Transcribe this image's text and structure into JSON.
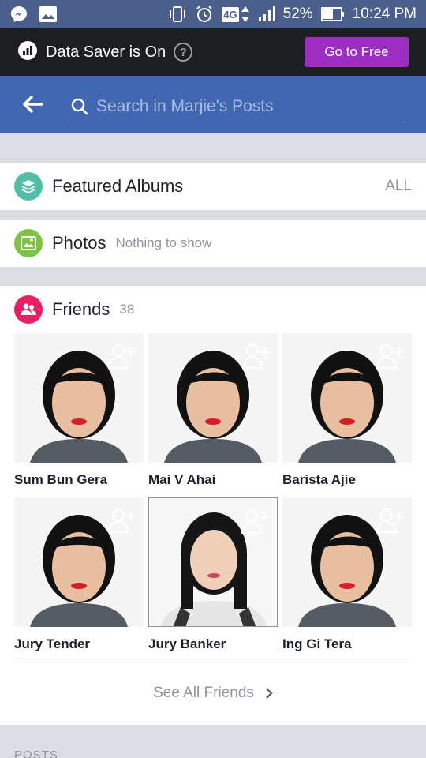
{
  "status_bar": {
    "icons_left": [
      "messenger-icon",
      "image-icon"
    ],
    "icons_right": [
      "vibrate-icon",
      "alarm-icon",
      "4g-icon",
      "signal-icon",
      "battery-icon"
    ],
    "network": "4G",
    "battery": "52%",
    "time": "10:24 PM"
  },
  "data_saver": {
    "label": "Data Saver is On",
    "help": "?",
    "button": "Go to Free",
    "button_color": "#9c2fc2"
  },
  "header": {
    "search_placeholder": "Search in Marjie's Posts",
    "bar_color": "#4267b2"
  },
  "featured_albums": {
    "title": "Featured Albums",
    "action": "ALL",
    "icon": "layers-icon",
    "icon_color": "#52c0a8"
  },
  "photos": {
    "title": "Photos",
    "status": "Nothing to show",
    "icon": "photo-icon",
    "icon_color": "#7fc246"
  },
  "friends": {
    "title": "Friends",
    "count": "38",
    "icon": "friends-icon",
    "icon_color": "#e91e63",
    "list": [
      {
        "name": "Sum Bun Gera"
      },
      {
        "name": "Mai V Ahai"
      },
      {
        "name": "Barista Ajie"
      },
      {
        "name": "Jury Tender"
      },
      {
        "name": "Jury Banker"
      },
      {
        "name": "Ing Gi Tera"
      }
    ],
    "see_all": "See All Friends"
  },
  "posts": {
    "label": "POSTS"
  }
}
